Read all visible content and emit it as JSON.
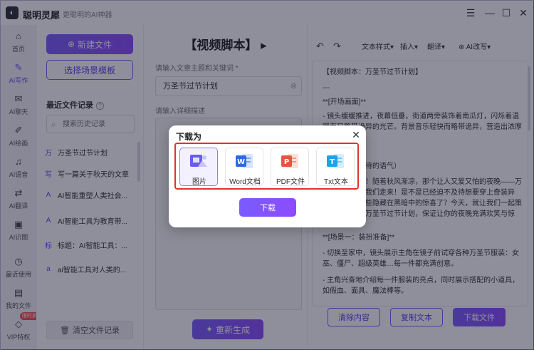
{
  "app": {
    "name": "聪明灵犀",
    "slogan": "更聪明的AI神器",
    "window_controls": {
      "menu": "☰",
      "minimize": "—",
      "maximize": "☐",
      "close": "✕"
    }
  },
  "sidebar": {
    "items": [
      {
        "label": "首页",
        "icon": "home-icon",
        "glyph": "⌂"
      },
      {
        "label": "AI写作",
        "icon": "pen-icon",
        "glyph": "✎"
      },
      {
        "label": "AI聊天",
        "icon": "chat-icon",
        "glyph": "✉"
      },
      {
        "label": "AI绘画",
        "icon": "brush-icon",
        "glyph": "✐"
      },
      {
        "label": "AI语音",
        "icon": "headphones-icon",
        "glyph": "♫"
      },
      {
        "label": "AI翻译",
        "icon": "translate-icon",
        "glyph": "⇄"
      },
      {
        "label": "AI识图",
        "icon": "image-icon",
        "glyph": "▣"
      },
      {
        "label": "最近使用",
        "icon": "clock-icon",
        "glyph": "◷"
      },
      {
        "label": "我的文件",
        "icon": "folder-icon",
        "glyph": "▤"
      },
      {
        "label": "VIP特权",
        "icon": "diamond-icon",
        "glyph": "◇"
      }
    ],
    "vip_badge": "限时折扣"
  },
  "files": {
    "new_button": "新建文件",
    "new_icon_glyph": "⊕",
    "template_button": "选择场景模板",
    "recent_title": "最近文件记录",
    "help_glyph": "?",
    "search_placeholder": "搜索历史记录",
    "search_glyph": "⌕",
    "items": [
      {
        "badge": "万",
        "name": "万圣节过节计划"
      },
      {
        "badge": "写",
        "name": "写一篇关于秋天的文章"
      },
      {
        "badge": "A",
        "name": "AI智能重塑人类社会..."
      },
      {
        "badge": "A",
        "name": "AI智能工具为教育带..."
      },
      {
        "badge": "标",
        "name": "标题：AI智能工具：..."
      },
      {
        "badge": "a",
        "name": "ai智能工具对人类的..."
      }
    ],
    "clear_button": "清空文件记录",
    "clear_glyph": "🗑"
  },
  "editor": {
    "title": "【视频脚本】",
    "title_arrow": "▸",
    "topic_label": "请输入文章主题和关键词 *",
    "topic_value": "万圣节过节计划",
    "clear_glyph": "⊗",
    "detail_label": "请输入详细描述",
    "regen_button": "重新生成",
    "regen_glyph": "✦"
  },
  "output": {
    "undo_glyph": "↶",
    "redo_glyph": "↷",
    "menus": [
      "文本样式▾",
      "插入▾",
      "翻译▾",
      "AI改写▾"
    ],
    "ai_glyph": "⊛",
    "lines": [
      "【视频脚本：万圣节过节计划】",
      "---",
      "**[开场画面]**",
      "- 镜头缓缓推进，夜幕低垂，街道两旁装饰着南瓜灯，闪烁着温暖而又略带诡异的光芒。背景音乐轻快而略带诡异，营造出浓厚的节日气氛。",
      "",
      "旁白（充满期待的语气）",
      "嘿，小伙伴们！随着秋风渐凉，那个让人又爱又怕的夜晚——万圣节又悄悄向我们走来！是不是已经迫不及待想要穿上奇装异服，去探索那些隐藏在黑暗中的惊喜了？今天，就让我们一起策划一场难忘的万圣节过节计划，保证让你的夜晚充满欢笑与惊喜！",
      "",
      "**[场景一：装扮准备]**",
      "- 切换至家中，镜头展示主角在镜子前试穿各种万圣节服装：女巫、僵尸、超级英雄…每一件都充满创意。",
      "- 主角兴奋地介绍每一件服装的亮点，同时展示搭配的小道具，如假血、面具、魔法棒等。"
    ],
    "clear_button": "清除内容",
    "copy_button": "复制文本",
    "download_button": "下载文件"
  },
  "modal": {
    "title": "下载为",
    "close_glyph": "✕",
    "options": [
      {
        "label": "图片",
        "icon": "image-file-icon",
        "badge": ""
      },
      {
        "label": "Word文档",
        "icon": "word-file-icon",
        "badge": "W"
      },
      {
        "label": "PDF文件",
        "icon": "pdf-file-icon",
        "badge": "P"
      },
      {
        "label": "Txt文本",
        "icon": "txt-file-icon",
        "badge": "T"
      }
    ],
    "download_button": "下载",
    "colors": {
      "accent": "#7a5cff",
      "highlight_border": "#e0342a",
      "word": "#2b6be6",
      "pdf": "#e8553f",
      "txt": "#1fa2e8",
      "image": "#6a5cf0"
    }
  }
}
